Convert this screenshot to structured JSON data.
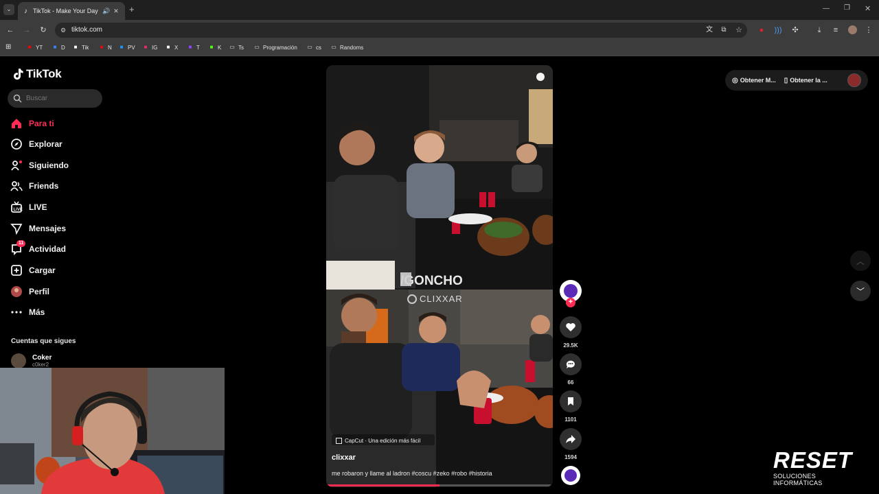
{
  "browser": {
    "tab_title": "TikTok - Make Your Day",
    "url": "tiktok.com",
    "bookmarks": [
      {
        "label": "YT",
        "icon": "youtube-icon",
        "color": "#ff0000"
      },
      {
        "label": "D",
        "icon": "d-icon",
        "color": "#3b82f6"
      },
      {
        "label": "Tik",
        "icon": "tiktok-icon",
        "color": "#ffffff"
      },
      {
        "label": "N",
        "icon": "netflix-icon",
        "color": "#e50914"
      },
      {
        "label": "PV",
        "icon": "primevideo-icon",
        "color": "#1a98ff"
      },
      {
        "label": "IG",
        "icon": "instagram-icon",
        "color": "#e1306c"
      },
      {
        "label": "X",
        "icon": "x-icon",
        "color": "#ffffff"
      },
      {
        "label": "T",
        "icon": "twitch-icon",
        "color": "#9146ff"
      },
      {
        "label": "K",
        "icon": "kick-icon",
        "color": "#53fc18"
      },
      {
        "label": "Ts",
        "icon": "folder-icon",
        "color": "#e4e4e4"
      },
      {
        "label": "Programación",
        "icon": "folder-icon",
        "color": "#e4e4e4"
      },
      {
        "label": "cs",
        "icon": "folder-icon",
        "color": "#e4e4e4"
      },
      {
        "label": "Randoms",
        "icon": "folder-icon",
        "color": "#e4e4e4"
      }
    ]
  },
  "app": {
    "logo": "TikTok",
    "search_placeholder": "Buscar",
    "nav": [
      {
        "label": "Para ti",
        "icon": "home-icon",
        "active": true
      },
      {
        "label": "Explorar",
        "icon": "compass-icon"
      },
      {
        "label": "Siguiendo",
        "icon": "user-following-icon"
      },
      {
        "label": "Friends",
        "icon": "friends-icon"
      },
      {
        "label": "LIVE",
        "icon": "live-icon"
      },
      {
        "label": "Mensajes",
        "icon": "send-icon"
      },
      {
        "label": "Actividad",
        "icon": "activity-icon",
        "badge": "11"
      },
      {
        "label": "Cargar",
        "icon": "plus-square-icon"
      },
      {
        "label": "Perfil",
        "icon": "avatar-icon"
      },
      {
        "label": "Más",
        "icon": "more-icon"
      }
    ],
    "following_title": "Cuentas que sigues",
    "following": [
      {
        "name": "Coker",
        "handle": "c0ker2"
      }
    ],
    "top_buttons": [
      "Obtener M...",
      "Obtener la ..."
    ]
  },
  "video": {
    "author": "clixxar",
    "caption": "me robaron y llame al ladron #coscu #zeko #robo #historia",
    "capcut_tag": "CapCut · Una edición más fácil",
    "watermark_top": "/GONCHO",
    "watermark_bottom": "CLIXXAR",
    "progress": 0.5,
    "likes": "29.5K",
    "comments": "66",
    "saves": "1101",
    "shares": "1594"
  },
  "overlay": {
    "brand": "RESET",
    "tagline": "SOLUCIONES INFORMÁTICAS"
  },
  "colors": {
    "accent": "#fe2c55",
    "background": "#000000"
  }
}
